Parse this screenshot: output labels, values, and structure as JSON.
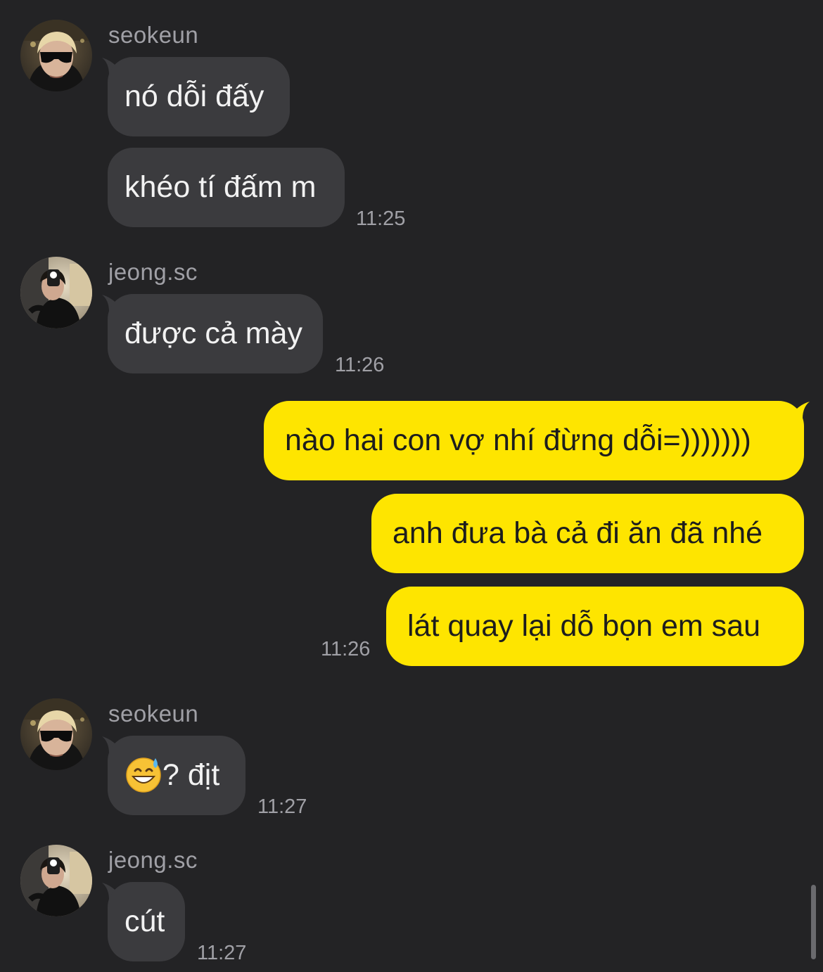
{
  "messages": [
    {
      "sender": "seokeun",
      "text1": "nó dỗi đấy",
      "text2": "khéo tí đấm m",
      "time": "11:25"
    },
    {
      "sender": "jeong.sc",
      "text": "được cả mày",
      "time": "11:26"
    },
    {
      "text1": "nào hai con vợ nhí đừng dỗi=)))))))",
      "text2": "anh đưa bà cả đi ăn đã nhé",
      "text3": "lát quay lại dỗ bọn em sau",
      "time": "11:26"
    },
    {
      "sender": "seokeun",
      "emoji": "grinning-face-with-sweat-icon",
      "text": "? địt",
      "time": "11:27"
    },
    {
      "sender": "jeong.sc",
      "text": "cút",
      "time": "11:27"
    }
  ],
  "colors": {
    "background": "#232325",
    "incoming_bubble": "#3b3b3e",
    "outgoing_bubble": "#fee500",
    "meta_text": "#a0a0a6"
  }
}
